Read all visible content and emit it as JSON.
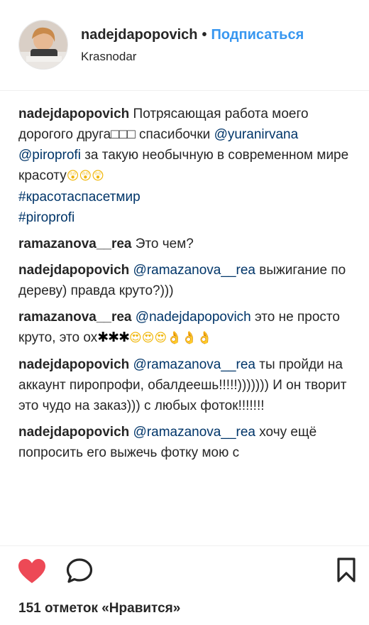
{
  "header": {
    "username": "nadejdapopovich",
    "separator": "•",
    "follow_label": "Подписаться",
    "location": "Krasnodar"
  },
  "comments": [
    {
      "user": "nadejdapopovich",
      "text1": "Потрясающая работа моего дорогого друга",
      "boxes": "□□□",
      "text2": "спасибочки",
      "mention1": "@yuranirvana",
      "mention2": "@piroprofi",
      "text3": "за такую необычную в современном мире красоту",
      "emojis": "😲😲😲",
      "tag1": "#красотаспасетмир",
      "tag2": "#piroprofi"
    },
    {
      "user": "ramazanova__rea",
      "text": "Это чем?"
    },
    {
      "user": "nadejdapopovich",
      "mention": "@ramazanova__rea",
      "text": "выжигание по дереву) правда круто?)))"
    },
    {
      "user": "ramazanova__rea",
      "mention": "@nadejdapopovich",
      "text1": "это не просто круто, это ох",
      "stars": "✱✱✱",
      "emojis": "😍😍😍👌👌👌"
    },
    {
      "user": "nadejdapopovich",
      "mention": "@ramazanova__rea",
      "text": "ты пройди на аккаунт пиропрофи, обалдеешь!!!!!))))))) И он творит это чудо на заказ))) с любых фоток!!!!!!!"
    },
    {
      "user": "nadejdapopovich",
      "mention": "@ramazanova__rea",
      "text": "хочу ещё попросить его выжечь фотку мою с"
    }
  ],
  "actions": {
    "like_icon": "heart-icon",
    "comment_icon": "comment-bubble-icon",
    "save_icon": "bookmark-icon",
    "like_color": "#ed4956"
  },
  "likes": "151 отметок «Нравится»"
}
